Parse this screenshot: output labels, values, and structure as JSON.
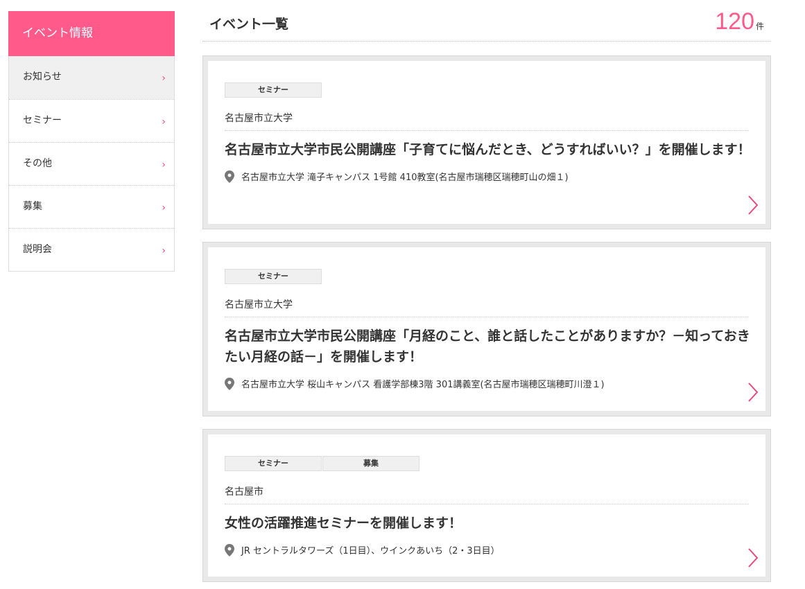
{
  "sidebar": {
    "header": "イベント情報",
    "items": [
      {
        "label": "お知らせ"
      },
      {
        "label": "セミナー"
      },
      {
        "label": "その他"
      },
      {
        "label": "募集"
      },
      {
        "label": "説明会"
      }
    ],
    "chevron": "›"
  },
  "main": {
    "title": "イベント一覧",
    "count": "120",
    "count_unit": "件"
  },
  "events": [
    {
      "tags": [
        "セミナー"
      ],
      "org": "名古屋市立大学",
      "title": "名古屋市立大学市民公開講座「子育てに悩んだとき、どうすればいい？」を開催します！",
      "location": "名古屋市立大学 滝子キャンパス 1号館 410教室(名古屋市瑞穂区瑞穂町山の畑１)"
    },
    {
      "tags": [
        "セミナー"
      ],
      "org": "名古屋市立大学",
      "title": "名古屋市立大学市民公開講座「月経のこと、誰と話したことがありますか？－知っておきたい月経の話－」を開催します！",
      "location": "名古屋市立大学 桜山キャンパス 看護学部棟3階 301講義室(名古屋市瑞穂区瑞穂町川澄１)"
    },
    {
      "tags": [
        "セミナー",
        "募集"
      ],
      "org": "名古屋市",
      "title": "女性の活躍推進セミナーを開催します！",
      "location": "JR セントラルタワーズ（1日目）、ウインクあいち（2・3日目）"
    }
  ],
  "colors": {
    "accent": "#ff5a8a",
    "chevron": "#e84b7a"
  }
}
